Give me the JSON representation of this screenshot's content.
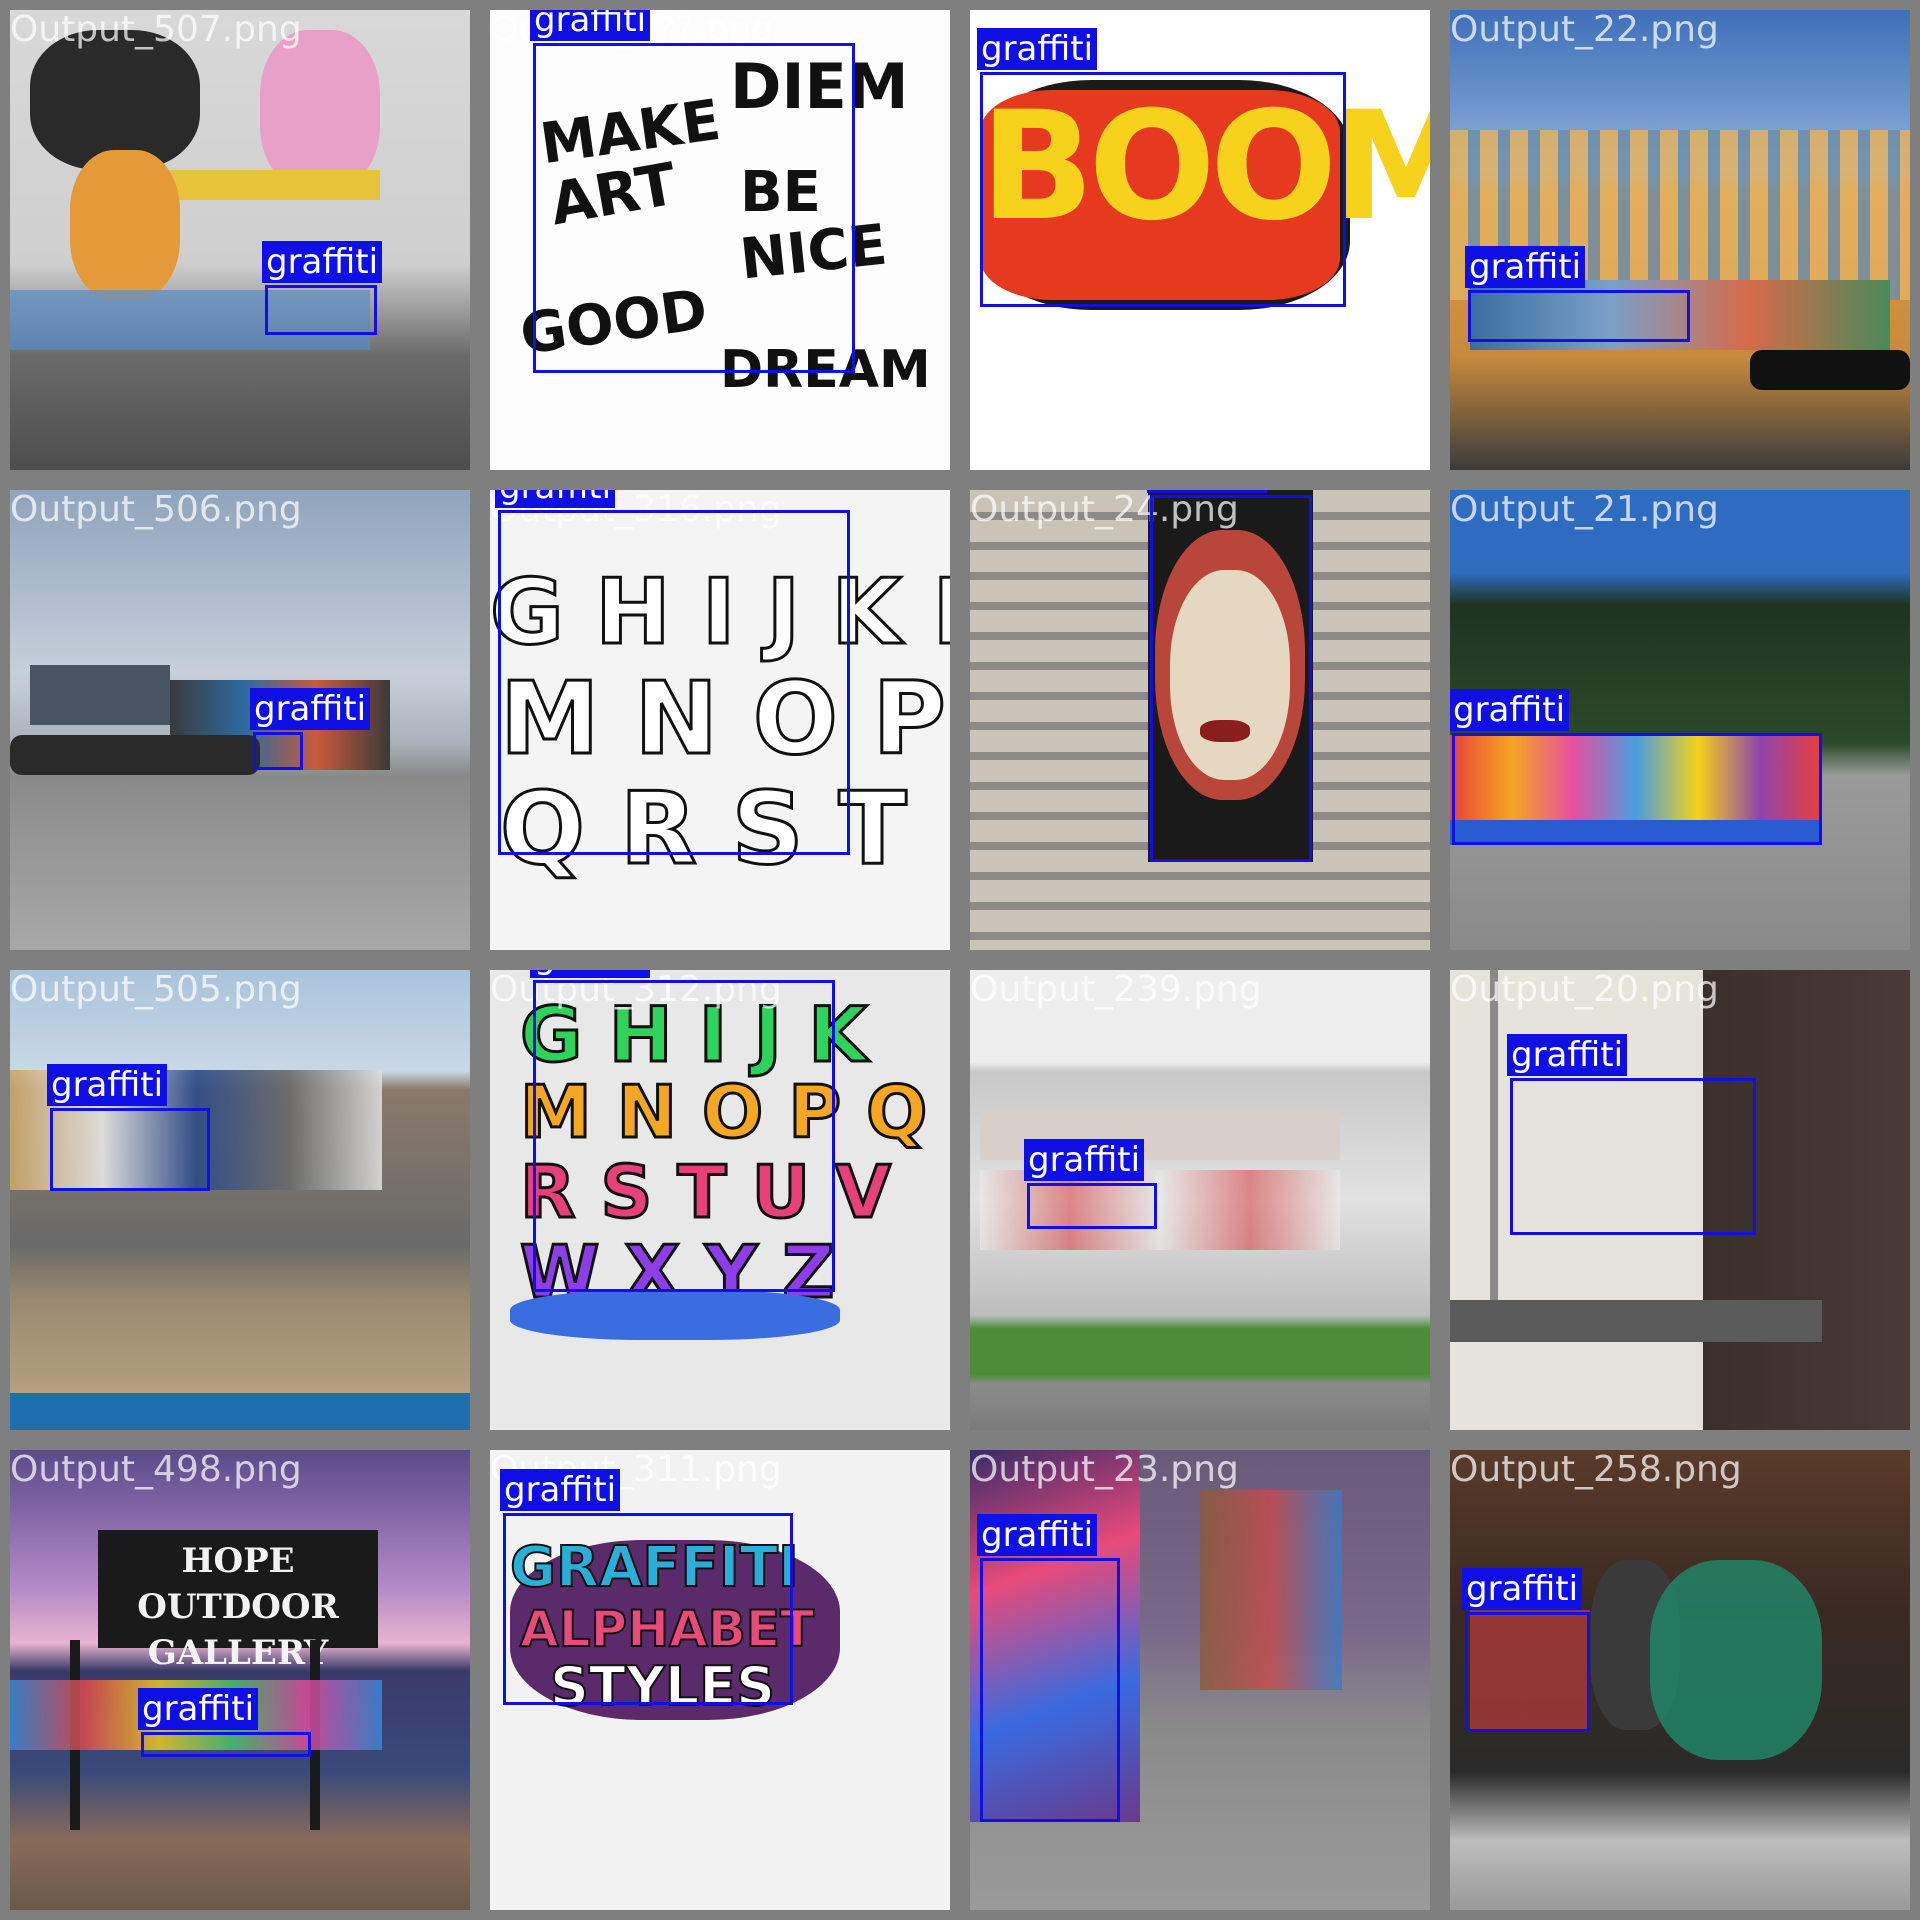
{
  "label_color": "#1010e6",
  "tiles": [
    {
      "file": "Output_507.png",
      "detections": [
        {
          "label": "graffiti"
        }
      ]
    },
    {
      "file": "Output_4??.png",
      "detections": [
        {
          "label": "graffiti"
        }
      ]
    },
    {
      "file": "Output_25.png",
      "detections": [
        {
          "label": "graffiti"
        }
      ]
    },
    {
      "file": "Output_22.png",
      "detections": [
        {
          "label": "graffiti"
        }
      ]
    },
    {
      "file": "Output_506.png",
      "detections": [
        {
          "label": "graffiti"
        }
      ]
    },
    {
      "file": "Output_316.png",
      "detections": [
        {
          "label": "graffiti"
        }
      ]
    },
    {
      "file": "Output_24.png",
      "detections": [
        {
          "label": "graffiti"
        }
      ]
    },
    {
      "file": "Output_21.png",
      "detections": [
        {
          "label": "graffiti"
        }
      ]
    },
    {
      "file": "Output_505.png",
      "detections": [
        {
          "label": "graffiti"
        }
      ]
    },
    {
      "file": "Output_312.png",
      "detections": [
        {
          "label": "graffiti"
        }
      ]
    },
    {
      "file": "Output_239.png",
      "detections": [
        {
          "label": "graffiti"
        }
      ]
    },
    {
      "file": "Output_20.png",
      "detections": [
        {
          "label": "graffiti"
        }
      ]
    },
    {
      "file": "Output_498.png",
      "detections": [
        {
          "label": "graffiti"
        }
      ],
      "sign": [
        "HOPE OUTDOOR",
        "GALLERY"
      ]
    },
    {
      "file": "Output_311.png",
      "detections": [
        {
          "label": "graffiti"
        }
      ],
      "art_text": [
        "GRAFFITI",
        "ALPHABET",
        "STYLES"
      ]
    },
    {
      "file": "Output_23.png",
      "detections": [
        {
          "label": "graffiti"
        }
      ]
    },
    {
      "file": "Output_258.png",
      "detections": [
        {
          "label": "graffiti"
        }
      ]
    }
  ],
  "tile_art": {
    "boom": "BOOM",
    "make_art": [
      "MAKE",
      "ART",
      "DIEM",
      "BE",
      "NICE",
      "GOOD",
      "DREAM"
    ],
    "bubble_a": [
      "G H I J K L",
      "M N O P",
      "Q R S T"
    ],
    "bubble_b": [
      "G H I J K",
      "M N O P Q",
      "R S T U V",
      "W X Y Z"
    ]
  }
}
